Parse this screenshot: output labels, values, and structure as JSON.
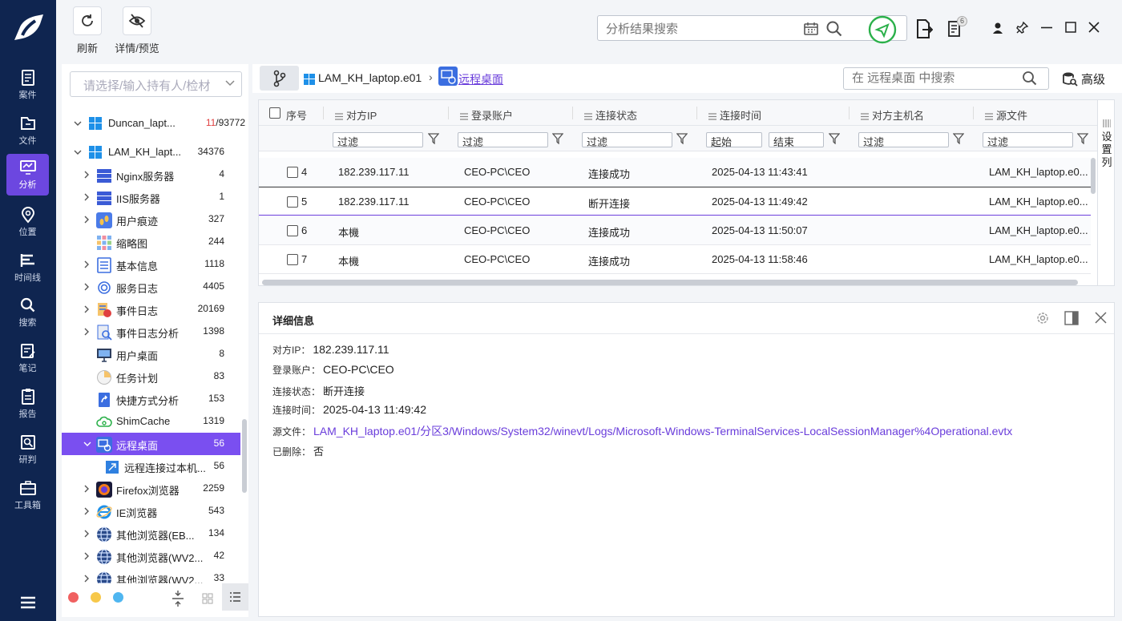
{
  "nav": {
    "items": [
      {
        "label": "案件",
        "icon": "case-icon"
      },
      {
        "label": "文件",
        "icon": "folder-icon"
      },
      {
        "label": "分析",
        "icon": "analysis-icon",
        "active": true
      },
      {
        "label": "位置",
        "icon": "location-icon"
      },
      {
        "label": "时间线",
        "icon": "timeline-icon"
      },
      {
        "label": "搜索",
        "icon": "search-icon"
      },
      {
        "label": "笔记",
        "icon": "note-icon"
      },
      {
        "label": "报告",
        "icon": "report-icon"
      },
      {
        "label": "研判",
        "icon": "judge-icon"
      },
      {
        "label": "工具箱",
        "icon": "toolbox-icon"
      }
    ]
  },
  "toolbar": {
    "refresh_label": "刷新",
    "details_label": "详情/预览",
    "search_placeholder": "分析结果搜索",
    "notification_count": "6"
  },
  "tree": {
    "select_placeholder": "请选择/输入持有人/检材",
    "devices": [
      {
        "label": "Duncan_lapt...",
        "count_red": "11",
        "count_rest": "/93772"
      },
      {
        "label": "LAM_KH_lapt...",
        "count": "34376"
      }
    ],
    "items": [
      {
        "label": "Nginx服务器",
        "count": "4"
      },
      {
        "label": "IIS服务器",
        "count": "1"
      },
      {
        "label": "用户痕迹",
        "count": "327"
      },
      {
        "label": "缩略图",
        "count": "244"
      },
      {
        "label": "基本信息",
        "count": "1118"
      },
      {
        "label": "服务日志",
        "count": "4405"
      },
      {
        "label": "事件日志",
        "count": "20169"
      },
      {
        "label": "事件日志分析",
        "count": "1398"
      },
      {
        "label": "用户桌面",
        "count": "8"
      },
      {
        "label": "任务计划",
        "count": "83"
      },
      {
        "label": "快捷方式分析",
        "count": "153"
      },
      {
        "label": "ShimCache",
        "count": "1319"
      },
      {
        "label": "远程桌面",
        "count": "56"
      },
      {
        "label": "远程连接过本机...",
        "count": "56"
      },
      {
        "label": "Firefox浏览器",
        "count": "2259"
      },
      {
        "label": "IE浏览器",
        "count": "543"
      },
      {
        "label": "其他浏览器(EB...",
        "count": "134"
      },
      {
        "label": "其他浏览器(WV2...",
        "count": "42"
      },
      {
        "label": "其他浏览器(WV2...",
        "count": "33"
      }
    ]
  },
  "crumb": {
    "device": "LAM_KH_laptop.e01",
    "current": "远程桌面",
    "search_placeholder": "在 远程桌面 中搜索",
    "advanced": "高级"
  },
  "table": {
    "columns": [
      "序号",
      "对方IP",
      "登录账户",
      "连接状态",
      "连接时间",
      "对方主机名",
      "源文件"
    ],
    "filters": {
      "text": "过滤",
      "start": "起始",
      "end": "结束"
    },
    "set_columns": [
      "设",
      "置",
      "列"
    ],
    "rows": [
      {
        "no": "4",
        "ip": "182.239.117.11",
        "account": "CEO-PC\\CEO",
        "status": "连接成功",
        "time": "2025-04-13 11:43:41",
        "host": "",
        "source": "LAM_KH_laptop.e0..."
      },
      {
        "no": "5",
        "ip": "182.239.117.11",
        "account": "CEO-PC\\CEO",
        "status": "断开连接",
        "time": "2025-04-13 11:49:42",
        "host": "",
        "source": "LAM_KH_laptop.e0..."
      },
      {
        "no": "6",
        "ip": "本機",
        "account": "CEO-PC\\CEO",
        "status": "连接成功",
        "time": "2025-04-13 11:50:07",
        "host": "",
        "source": "LAM_KH_laptop.e0..."
      },
      {
        "no": "7",
        "ip": "本機",
        "account": "CEO-PC\\CEO",
        "status": "连接成功",
        "time": "2025-04-13 11:58:46",
        "host": "",
        "source": "LAM_KH_laptop.e0..."
      }
    ]
  },
  "detail": {
    "title": "详细信息",
    "fields": [
      {
        "key": "对方IP：",
        "value": "182.239.117.11"
      },
      {
        "key": "登录账户：",
        "value": "CEO-PC\\CEO"
      },
      {
        "key": "连接状态：",
        "value": "断开连接"
      },
      {
        "key": "连接时间：",
        "value": "2025-04-13 11:49:42"
      },
      {
        "key": "源文件：",
        "value": "LAM_KH_laptop.e01/分区3/Windows/System32/winevt/Logs/Microsoft-Windows-TerminalServices-LocalSessionManager%4Operational.evtx"
      },
      {
        "key": "已删除：",
        "value": "否"
      }
    ]
  },
  "colors": {
    "accent": "#7a4ff0",
    "rail": "#0f2550",
    "link": "#6a3ddb",
    "green": "#2bb04a"
  }
}
